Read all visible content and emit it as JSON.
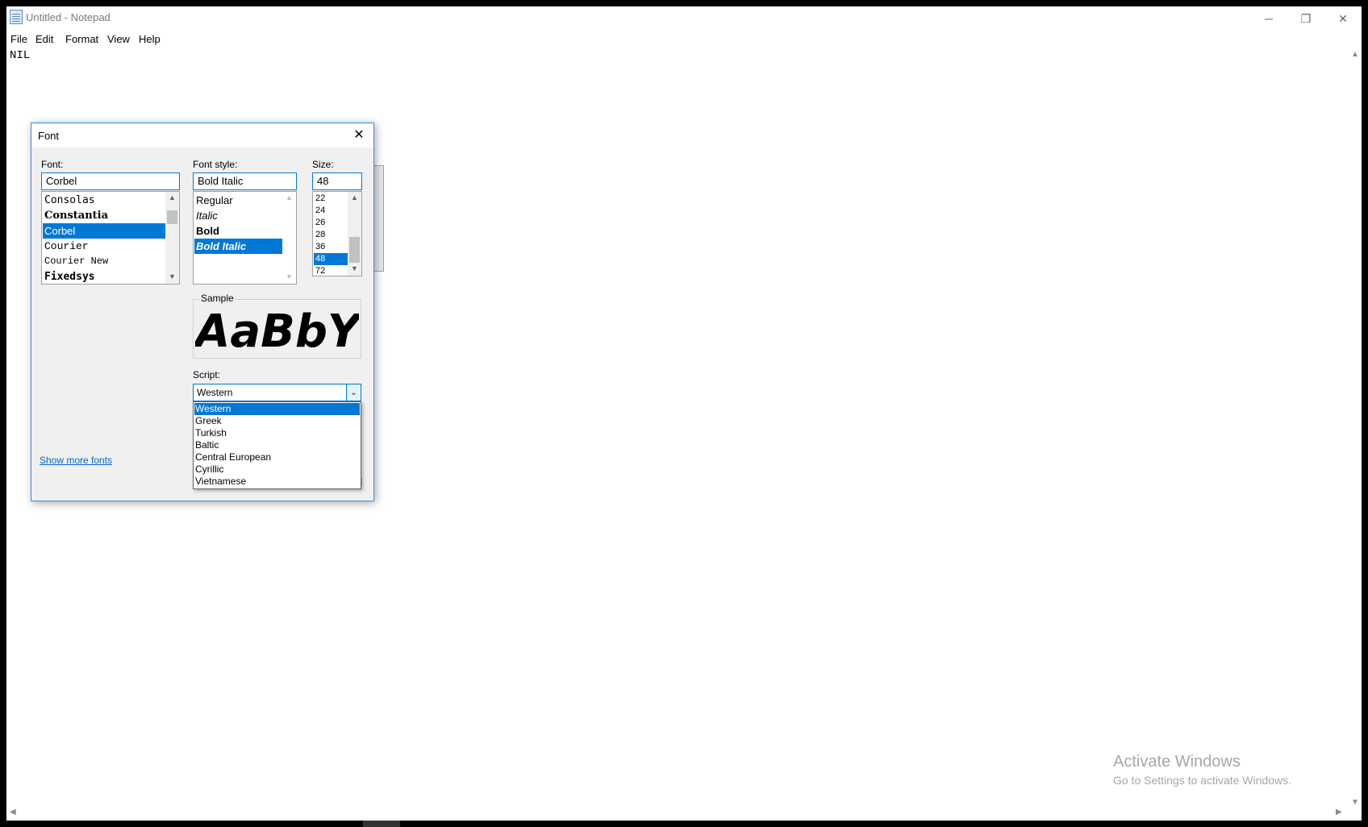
{
  "window": {
    "title": "Untitled - Notepad",
    "controls": {
      "minimize": "─",
      "maximize": "❐",
      "close": "✕"
    }
  },
  "menu": [
    "File",
    "Edit",
    "Format",
    "View",
    "Help"
  ],
  "editor": {
    "content": "NIL"
  },
  "watermark": {
    "title": "Activate Windows",
    "subtitle": "Go to Settings to activate Windows."
  },
  "dialog": {
    "title": "Font",
    "font": {
      "label": "Font:",
      "value": "Corbel",
      "items": [
        "Consolas",
        "Constantia",
        "Corbel",
        "Courier",
        "Courier New",
        "Fixedsys"
      ],
      "selected": "Corbel"
    },
    "style": {
      "label": "Font style:",
      "value": "Bold Italic",
      "items": [
        "Regular",
        "Italic",
        "Bold",
        "Bold Italic"
      ],
      "selected": "Bold Italic"
    },
    "size": {
      "label": "Size:",
      "value": "48",
      "items": [
        "22",
        "24",
        "26",
        "28",
        "36",
        "48",
        "72"
      ],
      "selected": "48"
    },
    "sample": {
      "label": "Sample",
      "text": "AaBbYyZz"
    },
    "script": {
      "label": "Script:",
      "value": "Western",
      "options": [
        "Western",
        "Greek",
        "Turkish",
        "Baltic",
        "Central European",
        "Cyrillic",
        "Vietnamese"
      ],
      "selected": "Western"
    },
    "show_more_fonts": "Show more fonts"
  },
  "colors": {
    "accent": "#0078d7",
    "dialog_bg": "#f0f0f0",
    "link": "#0066cc"
  },
  "icons": {
    "app": "notepad-icon",
    "close": "close-icon",
    "dropdown": "chevron-down-icon"
  }
}
